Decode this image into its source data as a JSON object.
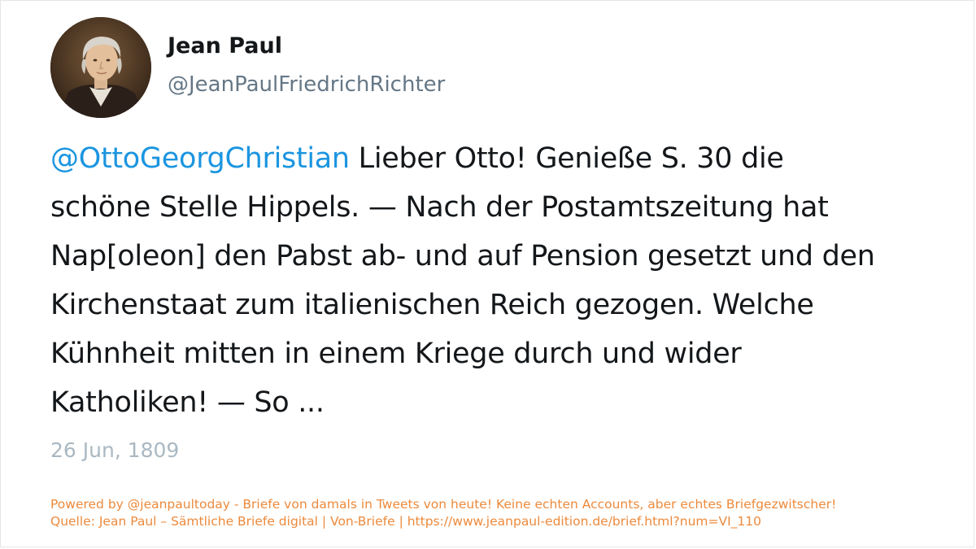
{
  "author": {
    "name": "Jean Paul",
    "handle": "@JeanPaulFriedrichRichter"
  },
  "tweet": {
    "mention": "@OttoGeorgChristian",
    "lines": [
      " Lieber Otto! Genieße S. 30 die",
      "schöne Stelle Hippels. — Nach der Postamtszeitung hat",
      "Nap[oleon] den Pabst ab- und auf Pension gesetzt und den",
      "Kirchenstaat zum italienischen Reich gezogen. Welche",
      "Kühnheit mitten in einem Kriege durch und wider",
      "Katholiken! — So ..."
    ],
    "date": "26 Jun, 1809"
  },
  "footer": {
    "line1": "Powered by @jeanpaultoday - Briefe von damals in Tweets von heute! Keine echten Accounts, aber echtes Briefgezwitscher!",
    "line2": "Quelle: Jean Paul – Sämtliche Briefe digital | Von-Briefe | https://www.jeanpaul-edition.de/brief.html?num=VI_110"
  },
  "colors": {
    "mention": "#1b95e0",
    "text": "#14171a",
    "handle": "#657786",
    "date": "#aab8c2",
    "footer": "#ec8a3c"
  }
}
